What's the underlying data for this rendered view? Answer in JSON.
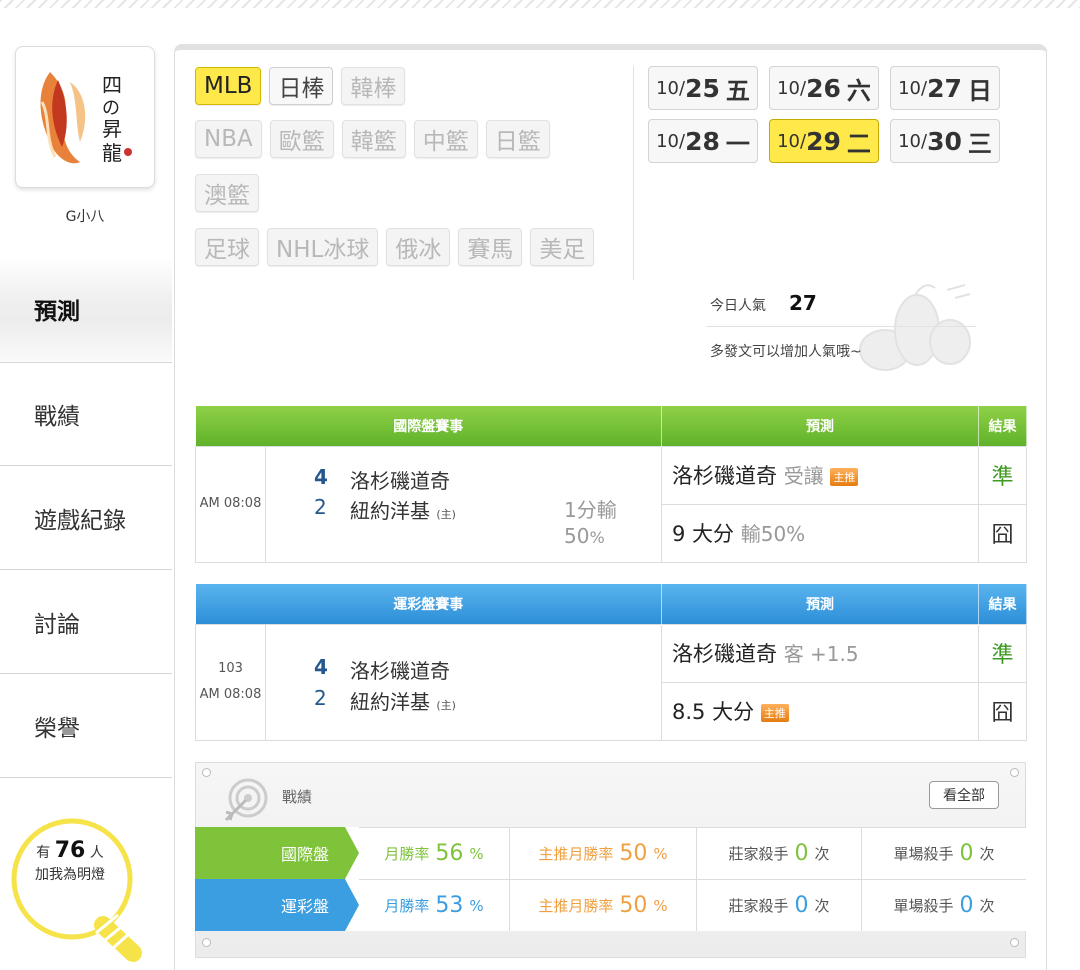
{
  "user": {
    "name": "G小八"
  },
  "nav": [
    {
      "label": "預測",
      "active": true
    },
    {
      "label": "戰績",
      "active": false
    },
    {
      "label": "遊戲紀錄",
      "active": false
    },
    {
      "label": "討論",
      "active": false
    },
    {
      "label": "榮譽",
      "active": false
    }
  ],
  "fans": {
    "prefix": "有",
    "count": "76",
    "suffix": "人",
    "line2": "加我為明燈"
  },
  "sports": {
    "row1": [
      "MLB",
      "日棒",
      "韓棒"
    ],
    "row2": [
      "NBA",
      "歐籃",
      "韓籃",
      "中籃",
      "日籃"
    ],
    "row3": [
      "澳籃"
    ],
    "row4": [
      "足球",
      "NHL冰球",
      "俄冰",
      "賽馬",
      "美足"
    ],
    "selected": "MLB"
  },
  "dates": [
    {
      "md": "10/",
      "dd": "25",
      "wk": "五"
    },
    {
      "md": "10/",
      "dd": "26",
      "wk": "六"
    },
    {
      "md": "10/",
      "dd": "27",
      "wk": "日"
    },
    {
      "md": "10/",
      "dd": "28",
      "wk": "一"
    },
    {
      "md": "10/",
      "dd": "29",
      "wk": "二"
    },
    {
      "md": "10/",
      "dd": "30",
      "wk": "三"
    }
  ],
  "popularity": {
    "label": "今日人氣",
    "value": "27",
    "hint": "多發文可以增加人氣哦~"
  },
  "intl": {
    "header": {
      "event": "國際盤賽事",
      "pred": "預測",
      "result": "結果"
    },
    "time": "AM 08:08",
    "home_score": "4",
    "home_team": "洛杉磯道奇",
    "away_score": "2",
    "away_team": "紐約洋基",
    "away_mark": "(主)",
    "spread": "1分輸",
    "spread_pct": "50",
    "spread_pct_unit": "%",
    "pred1": {
      "team": "洛杉磯道奇",
      "detail": "受讓",
      "badge": "主推",
      "result": "準"
    },
    "pred2": {
      "main": "9 大分",
      "detail": "輸50%",
      "result": "囧"
    }
  },
  "sportslottery": {
    "header": {
      "event": "運彩盤賽事",
      "pred": "預測",
      "result": "結果"
    },
    "num": "103",
    "time": "AM 08:08",
    "home_score": "4",
    "home_team": "洛杉磯道奇",
    "away_score": "2",
    "away_team": "紐約洋基",
    "away_mark": "(主)",
    "pred1": {
      "team": "洛杉磯道奇",
      "detail": "客 +1.5",
      "result": "準"
    },
    "pred2": {
      "main": "8.5 大分",
      "badge": "主推",
      "result": "囧"
    }
  },
  "stats": {
    "title": "戰績",
    "see_all": "看全部",
    "rows": [
      {
        "label": "國際盤",
        "month_label": "月勝率",
        "month": "56",
        "main_label": "主推月勝率",
        "main": "50",
        "killer_label": "莊家殺手",
        "killer": "0",
        "single_label": "單場殺手",
        "single": "0",
        "color": "#7ec33a"
      },
      {
        "label": "運彩盤",
        "month_label": "月勝率",
        "month": "53",
        "main_label": "主推月勝率",
        "main": "50",
        "killer_label": "莊家殺手",
        "killer": "0",
        "single_label": "單場殺手",
        "single": "0",
        "color": "#3a9ee0"
      }
    ],
    "pct": "%",
    "times": "次"
  }
}
